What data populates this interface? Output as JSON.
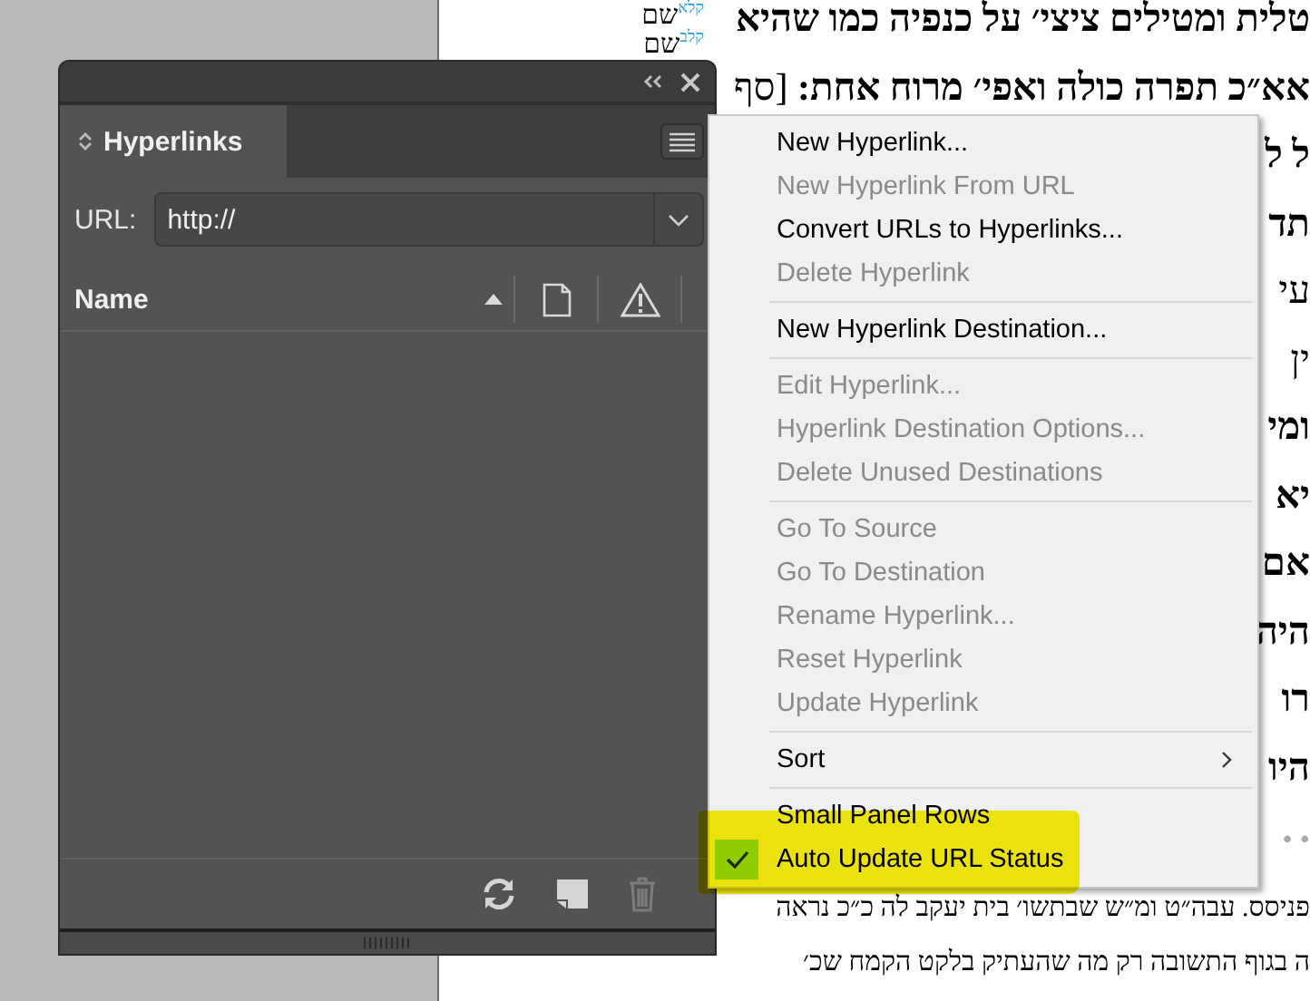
{
  "document": {
    "margin_notes": [
      "$^{קלא}$שם",
      "$^{קלב}$שם"
    ],
    "lines": [
      {
        "text": "טלית ומטילים ציצי׳ על כנפיה כמו שהיא",
        "kind": "bold"
      },
      {
        "text": "**אא״כ תפרה כולה ואפי׳ מרוח אחת:** [סף",
        "kind": "plain"
      },
      {
        "text": "ל ל",
        "kind": "bold"
      },
      {
        "text": "תד",
        "kind": "bold"
      },
      {
        "text": "עי",
        "kind": "plain"
      },
      {
        "text": "ין",
        "kind": "plain"
      },
      {
        "text": "ומי",
        "kind": "bold"
      },
      {
        "text": "יא",
        "kind": "bold"
      },
      {
        "text": "אם",
        "kind": "bold"
      },
      {
        "text": "היה",
        "kind": "bold"
      },
      {
        "text": "רו",
        "kind": "bold"
      },
      {
        "text": "היו",
        "kind": "bold"
      },
      {
        "text": "• •",
        "kind": "dots"
      },
      {
        "text": "פניסס. עבה״ט ומ״ש שבתשו׳ בית יעקב לה כ״כ נראה",
        "kind": "small"
      },
      {
        "text": "ה בגוף התשובה רק מה שהעתיק בלקט הקמח שכ׳",
        "kind": "small"
      }
    ]
  },
  "panel": {
    "tab": {
      "label": "Hyperlinks"
    },
    "url": {
      "label": "URL:",
      "value": "http://"
    },
    "columns": [
      {
        "label": "Name"
      }
    ],
    "footer_buttons": [
      {
        "kind": "refresh",
        "disabled": false
      },
      {
        "kind": "new",
        "disabled": false
      },
      {
        "kind": "delete",
        "disabled": true
      }
    ]
  },
  "menu": {
    "groups": [
      [
        {
          "label": "New Hyperlink...",
          "kind": "command",
          "disabled": false
        },
        {
          "label": "New Hyperlink From URL",
          "kind": "command",
          "disabled": true
        },
        {
          "label": "Convert URLs to Hyperlinks...",
          "kind": "command",
          "disabled": false
        },
        {
          "label": "Delete Hyperlink",
          "kind": "command",
          "disabled": true
        }
      ],
      [
        {
          "label": "New Hyperlink Destination...",
          "kind": "command",
          "disabled": false
        }
      ],
      [
        {
          "label": "Edit Hyperlink...",
          "kind": "command",
          "disabled": true
        },
        {
          "label": "Hyperlink Destination Options...",
          "kind": "command",
          "disabled": true
        },
        {
          "label": "Delete Unused Destinations",
          "kind": "command",
          "disabled": true
        }
      ],
      [
        {
          "label": "Go To Source",
          "kind": "command",
          "disabled": true
        },
        {
          "label": "Go To Destination",
          "kind": "command",
          "disabled": true
        },
        {
          "label": "Rename Hyperlink...",
          "kind": "command",
          "disabled": true
        },
        {
          "label": "Reset Hyperlink",
          "kind": "command",
          "disabled": true
        },
        {
          "label": "Update Hyperlink",
          "kind": "command",
          "disabled": true
        }
      ],
      [
        {
          "label": "Sort",
          "kind": "submenu",
          "disabled": false
        }
      ],
      [
        {
          "label": "Small Panel Rows",
          "kind": "check",
          "disabled": false,
          "checked": false
        },
        {
          "label": "Auto Update URL Status",
          "kind": "check",
          "disabled": false,
          "checked": true
        }
      ]
    ]
  }
}
